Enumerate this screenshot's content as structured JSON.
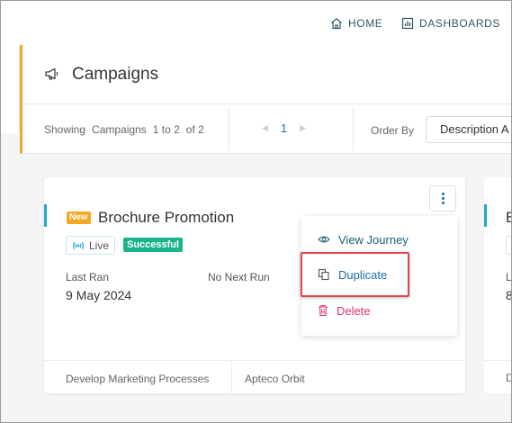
{
  "nav": {
    "home_label": "HOME",
    "dashboards_label": "DASHBOARDS"
  },
  "page": {
    "title": "Campaigns"
  },
  "toolbar": {
    "showing_label": "Showing",
    "entity_label": "Campaigns",
    "range_text": "1 to 2",
    "of_text": "of 2",
    "current_page": "1",
    "order_by_label": "Order By",
    "order_by_value": "Description A"
  },
  "card": {
    "new_badge": "New",
    "title": "Brochure Promotion",
    "live_label": "Live",
    "status_badge": "Successful",
    "last_ran_label": "Last Ran",
    "last_ran_value": "9 May 2024",
    "next_run_text": "No Next Run",
    "footer_left": "Develop Marketing Processes",
    "footer_right": "Apteco Orbit"
  },
  "menu": {
    "items": [
      {
        "label": "View Journey",
        "icon": "eye-icon"
      },
      {
        "label": "Duplicate",
        "icon": "copy-icon"
      },
      {
        "label": "Delete",
        "icon": "trash-icon"
      }
    ]
  },
  "card2": {
    "title_fragment": "B",
    "label_fragment": "La",
    "value_fragment": "8",
    "footer_fragment": "De"
  },
  "colors": {
    "accent_orange": "#f5a623",
    "accent_blue": "#22a6d8",
    "link_blue": "#1a6ca8",
    "success_green": "#1ab38a",
    "delete_pink": "#e0306f",
    "highlight_red": "#e2454c"
  }
}
